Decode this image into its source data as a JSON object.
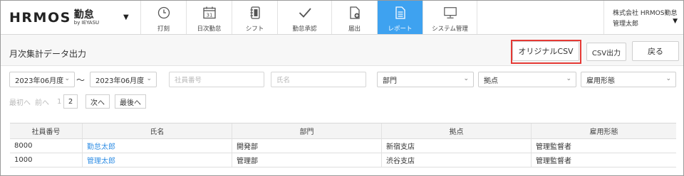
{
  "header": {
    "logo": "HRMOS",
    "logo_product": "勤怠",
    "logo_by": "by IEYASU",
    "nav": [
      {
        "label": "打刻",
        "icon": "clock-icon"
      },
      {
        "label": "日次勤怠",
        "icon": "calendar-icon"
      },
      {
        "label": "シフト",
        "icon": "notebook-icon"
      },
      {
        "label": "勤怠承認",
        "icon": "checkmark-icon"
      },
      {
        "label": "届出",
        "icon": "document-icon"
      },
      {
        "label": "レポート",
        "icon": "report-icon"
      },
      {
        "label": "システム管理",
        "icon": "monitor-icon"
      }
    ],
    "active_nav": "レポート",
    "calendar_day": "31",
    "company": "株式会社 HRMOS勤怠",
    "user": "管理太郎"
  },
  "titlebar": {
    "title": "月次集計データ出力",
    "original_csv_label": "オリジナルCSV",
    "csv_label": "CSV出力",
    "back_label": "戻る"
  },
  "filters": {
    "month_from": "2023年06月度",
    "separator": "〜",
    "month_to": "2023年06月度",
    "employee_no_placeholder": "社員番号",
    "name_placeholder": "氏名",
    "department": "部門",
    "location": "拠点",
    "employment_type": "雇用形態"
  },
  "pager": {
    "first": "最初へ",
    "prev": "前へ",
    "page1": "1",
    "page2": "2",
    "next": "次へ",
    "last": "最後へ"
  },
  "table": {
    "columns": [
      "社員番号",
      "氏名",
      "部門",
      "拠点",
      "雇用形態"
    ],
    "rows": [
      {
        "id": "8000",
        "name": "勤怠太郎",
        "dept": "開発部",
        "loc": "新宿支店",
        "emp": "管理監督者"
      },
      {
        "id": "1000",
        "name": "管理太郎",
        "dept": "管理部",
        "loc": "渋谷支店",
        "emp": "管理監督者"
      }
    ]
  },
  "colors": {
    "active_nav_bg": "#3ea2f0",
    "link": "#2f8de4",
    "highlight": "#e53935"
  }
}
